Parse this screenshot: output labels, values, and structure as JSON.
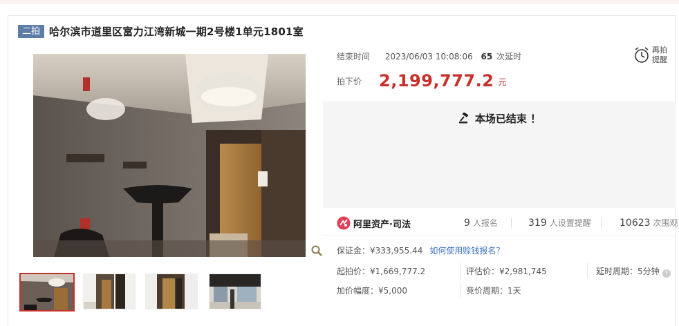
{
  "listing": {
    "badge": "二拍",
    "title": "哈尔滨市道里区富力江湾新城一期2号楼1单元1801室"
  },
  "auction": {
    "end_label": "结束时间",
    "end_time": "2023/06/03 10:08:06",
    "delay_count": "65",
    "delay_unit": "次延时",
    "remind_label_line1": "再拍",
    "remind_label_line2": "提醒",
    "price_label": "拍下价",
    "price": "2,199,777.2",
    "price_unit": "元",
    "ended_text": "本场已结束 ！"
  },
  "platform": {
    "name": "阿里资产·司法"
  },
  "stats": {
    "signup_count": "9",
    "signup_unit": "人报名",
    "reminder_count": "319",
    "reminder_unit": "人设置提醒",
    "watch_count": "10623",
    "watch_unit": "次围观"
  },
  "deposit": {
    "text": "保证金：¥333,955.44",
    "link": "如何使用赊钱报名？"
  },
  "terms": {
    "start_price": "起拍价：¥1,669,777.2",
    "appraisal": "评估价：¥2,981,745",
    "delay_period": "延时周期：5分钟",
    "increment": "加价幅度：¥5,000",
    "bid_period": "竞价周期：1天"
  },
  "colors": {
    "accent_red": "#c9302c",
    "badge_blue": "#5d7da6",
    "link_blue": "#3a6fc4"
  }
}
